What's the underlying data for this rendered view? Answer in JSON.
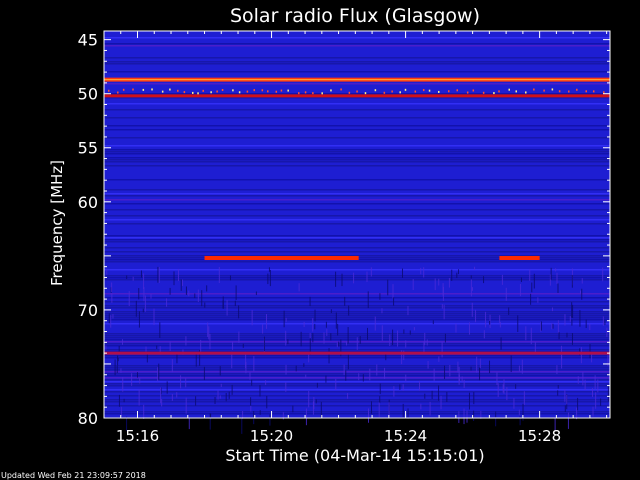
{
  "chart_data": {
    "type": "heatmap",
    "title": "Solar radio Flux (Glasgow)",
    "xlabel": "Start Time (04-Mar-14 15:15:01)",
    "ylabel": "Frequency [MHz]",
    "x_ticks": [
      "15:16",
      "15:20",
      "15:24",
      "15:28"
    ],
    "x_tick_minutes": [
      1,
      5,
      9,
      13
    ],
    "x_range_minutes": [
      0,
      15.1
    ],
    "y_ticks": [
      45,
      50,
      55,
      60,
      65,
      70,
      75,
      80
    ],
    "y_tick_labels": [
      "45",
      "50",
      "55",
      "60",
      "",
      "70",
      "",
      "80"
    ],
    "ylim": [
      80,
      44.2
    ],
    "colormap": [
      "#000066",
      "#1a1acc",
      "#2a2ae6",
      "#7a00c8",
      "#ff2200",
      "#ffff00"
    ],
    "emission_features": [
      {
        "freq_mhz": 48.7,
        "t_start_min": 0,
        "t_end_min": 15.1,
        "level": 0.95
      },
      {
        "freq_mhz": 50.2,
        "t_start_min": 0,
        "t_end_min": 15.1,
        "level": 0.6
      },
      {
        "freq_mhz": 65.2,
        "t_start_min": 3.0,
        "t_end_min": 7.6,
        "level": 0.9
      },
      {
        "freq_mhz": 65.2,
        "t_start_min": 11.8,
        "t_end_min": 13.0,
        "level": 0.9
      },
      {
        "freq_mhz": 74.0,
        "t_start_min": 0,
        "t_end_min": 15.1,
        "level": 0.5
      }
    ]
  },
  "footer": {
    "updated": "Updated Wed Feb 21 23:09:57 2018"
  },
  "colors": {
    "background": "#000000",
    "text": "#ffffff"
  }
}
